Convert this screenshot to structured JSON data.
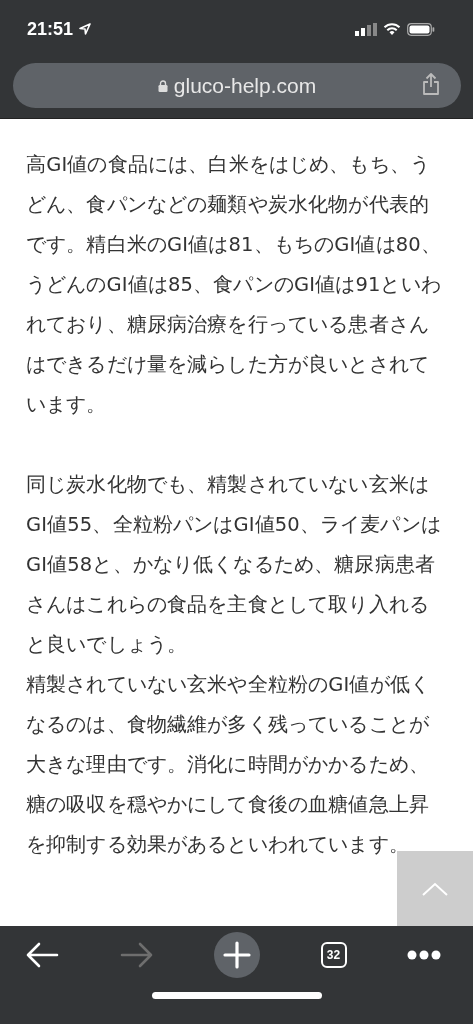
{
  "status_bar": {
    "time": "21:51"
  },
  "address_bar": {
    "url": "gluco-help.com"
  },
  "sections": [
    {
      "paragraphs": [
        "高GI値の食品には、白米をはじめ、もち、うどん、食パンなどの麺類や炭水化物が代表的です。精白米のGI値は81、もちのGI値は80、うどんのGI値は85、食パンのGI値は91といわれており、糖尿病治療を行っている患者さんはできるだけ量を減らした方が良いとされています。"
      ]
    },
    {
      "paragraphs": [
        "同じ炭水化物でも、精製されていない玄米はGI値55、全粒粉パンはGI値50、ライ麦パンはGI値58と、かなり低くなるため、糖尿病患者さんはこれらの食品を主食として取り入れると良いでしょう。",
        "精製されていない玄米や全粒粉のGI値が低くなるのは、食物繊維が多く残っていることが大きな理由です。消化に時間がかかるため、糖の吸収を穏やかにして食後の血糖値急上昇を抑制する効果があるといわれています。"
      ]
    }
  ],
  "toolbar": {
    "tab_count": "32",
    "forward_disabled": true
  }
}
